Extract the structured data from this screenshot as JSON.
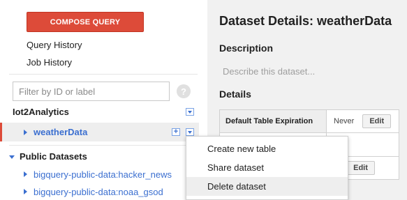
{
  "sidebar": {
    "compose_label": "COMPOSE QUERY",
    "nav": [
      "Query History",
      "Job History"
    ],
    "filter_placeholder": "Filter by ID or label",
    "help_glyph": "?",
    "project": "Iot2Analytics",
    "selected_dataset": "weatherData",
    "public_title": "Public Datasets",
    "public_items": [
      "bigquery-public-data:hacker_news",
      "bigquery-public-data:noaa_gsod"
    ]
  },
  "main": {
    "title": "Dataset Details: weatherData",
    "description_heading": "Description",
    "description_placeholder": "Describe this dataset...",
    "details_heading": "Details",
    "details_rows": [
      {
        "key": "Default Table Expiration",
        "value": "Never",
        "action": "Edit"
      },
      {
        "key": "",
        "value": "e",
        "action": "Edit"
      }
    ]
  },
  "context_menu": {
    "items": [
      "Create new table",
      "Share dataset",
      "Delete dataset"
    ],
    "highlighted": "Delete dataset"
  },
  "colors": {
    "accent_red": "#dd4b39",
    "link_blue": "#3b6fd0",
    "panel_bg": "#f1f1f1"
  }
}
